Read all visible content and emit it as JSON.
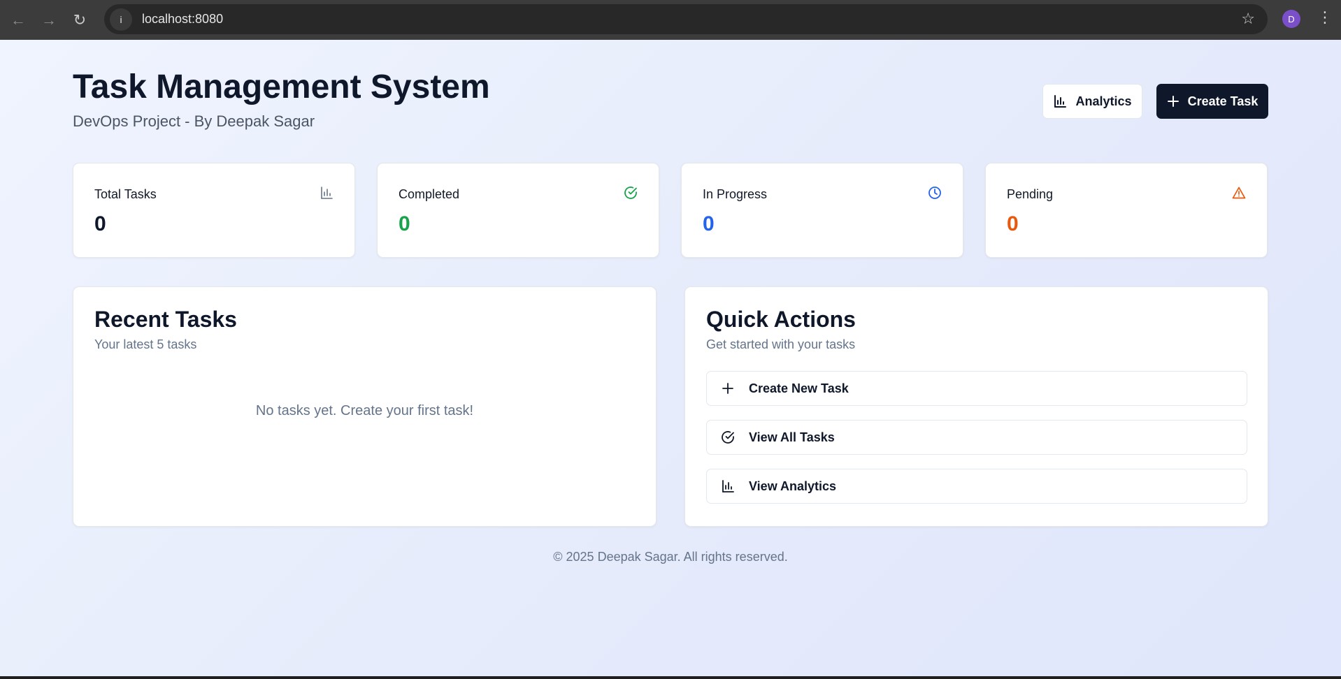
{
  "browser": {
    "url": "localhost:8080",
    "profile_initial": "D",
    "icons": {
      "back": "arrow-left-icon",
      "forward": "arrow-right-icon",
      "reload": "reload-icon",
      "info": "info-icon",
      "star": "star-icon",
      "menu": "kebab-menu-icon"
    }
  },
  "header": {
    "title": "Task Management System",
    "subtitle": "DevOps Project - By Deepak Sagar",
    "analytics_label": "Analytics",
    "create_label": "Create Task"
  },
  "stats": [
    {
      "label": "Total Tasks",
      "value": "0",
      "color": "#0f172a",
      "icon": "bar-chart-icon"
    },
    {
      "label": "Completed",
      "value": "0",
      "color": "#16a34a",
      "icon": "check-circle-icon"
    },
    {
      "label": "In Progress",
      "value": "0",
      "color": "#2563eb",
      "icon": "clock-icon"
    },
    {
      "label": "Pending",
      "value": "0",
      "color": "#ea580c",
      "icon": "warning-icon"
    }
  ],
  "recent": {
    "title": "Recent Tasks",
    "subtitle": "Your latest 5 tasks",
    "empty": "No tasks yet. Create your first task!"
  },
  "quick": {
    "title": "Quick Actions",
    "subtitle": "Get started with your tasks",
    "actions": [
      {
        "label": "Create New Task",
        "icon": "plus-icon"
      },
      {
        "label": "View All Tasks",
        "icon": "check-circle-icon"
      },
      {
        "label": "View Analytics",
        "icon": "bar-chart-icon"
      }
    ]
  },
  "footer": {
    "text": "© 2025 Deepak Sagar. All rights reserved."
  },
  "colors": {
    "primary": "#0f172a",
    "green": "#16a34a",
    "blue": "#2563eb",
    "orange": "#ea580c",
    "muted": "#64748b"
  }
}
